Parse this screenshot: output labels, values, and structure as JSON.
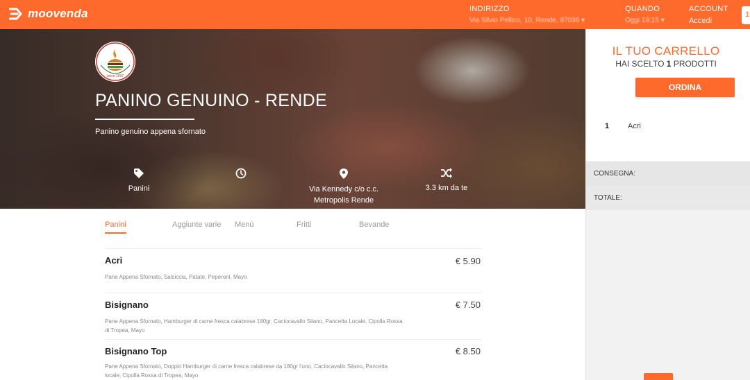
{
  "header": {
    "brand": "moovenda",
    "address_label": "INDIRIZZO",
    "address_value": "Via Silvio Pellico, 10, Rende, 87036 ▾",
    "when_label": "QUANDO",
    "when_value": "Oggi 19:15 ▾",
    "account_label": "ACCOUNT",
    "account_value": "Accedi",
    "cart_badge": "1"
  },
  "restaurant": {
    "logo_text": "Panino Genuino",
    "name": "PANINO GENUINO - RENDE",
    "tagline": "Panino genuino appena sfornato",
    "info": [
      {
        "icon": "tag-icon",
        "text": "Panini"
      },
      {
        "icon": "clock-icon",
        "text": ""
      },
      {
        "icon": "map-pin-icon",
        "text": "Via Kennedy c/o c.c.\nMetropolis Rende"
      },
      {
        "icon": "shuffle-icon",
        "text": "3.3 km da te"
      }
    ]
  },
  "tabs": [
    "Panini",
    "Aggiunte varie",
    "Menù",
    "Fritti",
    "Bevande"
  ],
  "menu": [
    {
      "name": "Acri",
      "price": "€ 5.90",
      "desc": "Pane Appena Sfornato, Salsiccia, Patate, Peperoni, Mayo"
    },
    {
      "name": "Bisignano",
      "price": "€ 7.50",
      "desc": "Pane Appena Sfornato, Hamburger di carne fresca calabrese 180gr, Caciocavallo Silano, Pancetta Locale, Cipolla Rossa di Tropea, Mayo"
    },
    {
      "name": "Bisignano Top",
      "price": "€ 8.50",
      "desc": "Pane Appena Sfornato, Doppio Hamburger di carne fresca calabrese da 180gr l'uno, Caciocavallo Silano, Pancetta locale, Cipolla Rossa di Tropea, Mayo"
    }
  ],
  "cart": {
    "title": "IL TUO CARRELLO",
    "count_prefix": "HAI SCELTO",
    "count": "1",
    "count_suffix": "PRODOTTI",
    "order_label": "ORDINA",
    "line_qty": "1",
    "line_name": "Acri",
    "delivery_label": "CONSEGNA:",
    "total_label": "TOTALE:"
  },
  "colors": {
    "accent": "#fd6a2c"
  }
}
